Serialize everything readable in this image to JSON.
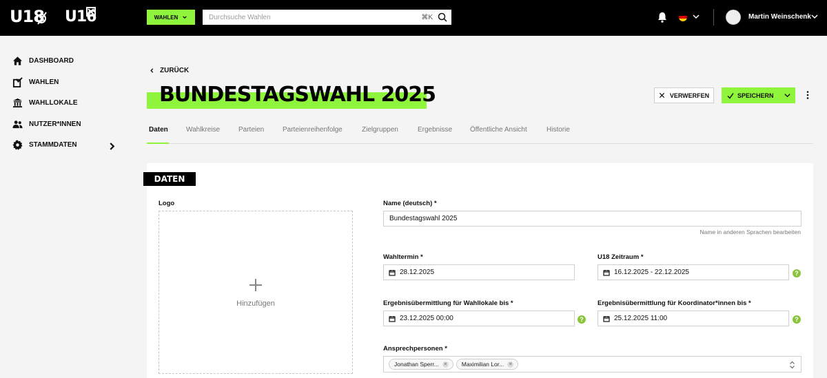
{
  "topbar": {
    "logo_primary": "U18",
    "logo_secondary": "U16",
    "elections_button": "WAHLEN",
    "search_placeholder": "Durchsuche Wahlen",
    "search_shortcut": "⌘K",
    "user_name": "Martin Weinschenk",
    "icons": [
      "bell-icon",
      "flag-de-icon",
      "chevron-down-icon",
      "avatar",
      "search-icon"
    ]
  },
  "sidebar": {
    "items": [
      {
        "label": "DASHBOARD",
        "icon": "home-icon"
      },
      {
        "label": "WAHLEN",
        "icon": "ballot-box-icon"
      },
      {
        "label": "WAHLLOKALE",
        "icon": "building-icon"
      },
      {
        "label": "NUTZER*INNEN",
        "icon": "users-icon"
      },
      {
        "label": "STAMMDATEN",
        "icon": "gear-icon"
      }
    ]
  },
  "header": {
    "back_label": "ZURÜCK",
    "title": "BUNDESTAGSWAHL 2025",
    "discard_label": "VERWERFEN",
    "save_label": "SPEICHERN"
  },
  "tabs": [
    {
      "label": "Daten",
      "active": true
    },
    {
      "label": "Wahlkreise",
      "active": false
    },
    {
      "label": "Parteien",
      "active": false
    },
    {
      "label": "Parteienreihenfolge",
      "active": false
    },
    {
      "label": "Zielgruppen",
      "active": false
    },
    {
      "label": "Ergebnisse",
      "active": false
    },
    {
      "label": "Öffentliche Ansicht",
      "active": false
    },
    {
      "label": "Historie",
      "active": false
    }
  ],
  "form": {
    "section_title": "DATEN",
    "logo": {
      "label": "Logo",
      "add_label": "Hinzufügen"
    },
    "name": {
      "label": "Name (deutsch) *",
      "value": "Bundestagswahl 2025",
      "hint": "Name in anderen Sprachen bearbeiten"
    },
    "election_date": {
      "label": "Wahltermin *",
      "value": "28.12.2025"
    },
    "u18_period": {
      "label": "U18 Zeitraum *",
      "value": "16.12.2025 - 22.12.2025"
    },
    "result_polling_station": {
      "label": "Ergebnisübermittlung für Wahllokale bis *",
      "value": "23.12.2025 00:00"
    },
    "result_coordinator": {
      "label": "Ergebnisübermittlung für Koordinator*innen bis *",
      "value": "25.12.2025 11:00"
    },
    "contacts": {
      "label": "Ansprechpersonen *",
      "chips": [
        "Jonathan Sperr...",
        "Maximilian Lor..."
      ]
    },
    "help_glyph": "?"
  },
  "colors": {
    "accent": "#8ff43c",
    "topbar_bg": "#000000",
    "page_bg": "#f4f4f5",
    "help_icon": "#8ac43e"
  }
}
